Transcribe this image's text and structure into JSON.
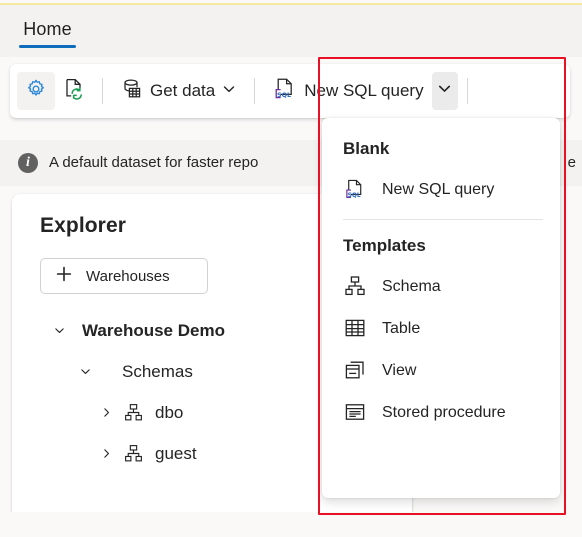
{
  "window": {
    "accent_blue": "#0f6cbd",
    "annotation_color": "#e81123",
    "sql_icon_color": "#5b2d90",
    "sql_text_color": "#2b66c2"
  },
  "tabstrip": {
    "tabs": [
      {
        "label": "Home",
        "selected": true
      }
    ]
  },
  "toolbar": {
    "settings_button": {
      "icon": "gear-icon",
      "label": "Settings"
    },
    "refresh_button": {
      "icon": "refresh-document-icon",
      "label": "Refresh"
    },
    "get_data": {
      "icon": "database-table-icon",
      "label": "Get data",
      "chevron": "chevron-down-icon"
    },
    "new_sql_query": {
      "icon": "sql-file-icon",
      "label": "New SQL query",
      "chevron": "chevron-down-icon",
      "expanded": true
    }
  },
  "infobar": {
    "icon": "info-icon",
    "text": "A default dataset for faster repo",
    "text_right_fragment": "e"
  },
  "explorer": {
    "title": "Explorer",
    "warehouses_button": {
      "icon": "plus-icon",
      "label": "Warehouses"
    },
    "tree": [
      {
        "label": "Warehouse Demo",
        "twisty": "chevron-down-icon",
        "indent": 0,
        "bold": true,
        "icon": null
      },
      {
        "label": "Schemas",
        "twisty": "chevron-down-icon",
        "indent": 1,
        "bold": false,
        "icon": null
      },
      {
        "label": "dbo",
        "twisty": "chevron-right-icon",
        "indent": 2,
        "bold": false,
        "icon": "schema-icon"
      },
      {
        "label": "guest",
        "twisty": "chevron-right-icon",
        "indent": 2,
        "bold": false,
        "icon": "schema-icon"
      }
    ]
  },
  "dropdown": {
    "sections": [
      {
        "header": "Blank",
        "items": [
          {
            "label": "New SQL query",
            "icon": "sql-file-icon"
          }
        ]
      },
      {
        "header": "Templates",
        "items": [
          {
            "label": "Schema",
            "icon": "schema-icon"
          },
          {
            "label": "Table",
            "icon": "table-icon"
          },
          {
            "label": "View",
            "icon": "view-icon"
          },
          {
            "label": "Stored procedure",
            "icon": "stored-procedure-icon"
          }
        ]
      }
    ]
  }
}
